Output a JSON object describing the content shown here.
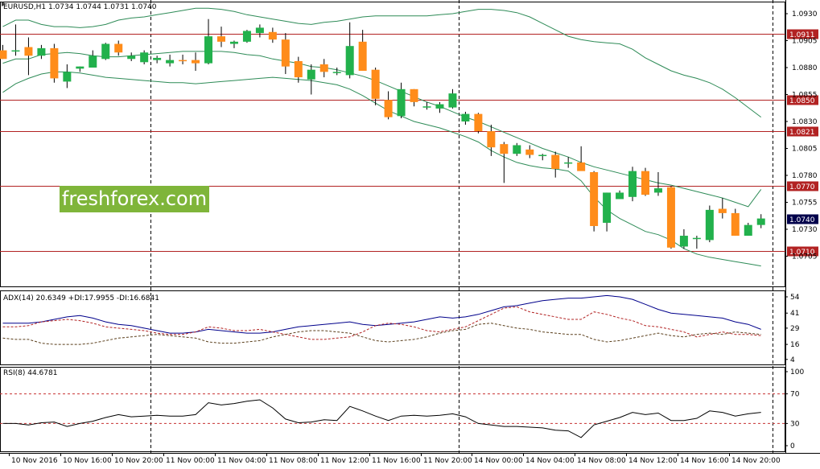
{
  "symbol_header": "EURUSD,H1  1.0734 1.0744 1.0731 1.0740",
  "brand_text": "freshforex.com",
  "colors": {
    "bull": "#22b14c",
    "bear": "#ff8c1a",
    "level": "#b22222",
    "band": "#2e8b57",
    "adx": "#00008b",
    "di_plus": "#b22222",
    "di_minus": "#5a3e1b",
    "rsi": "#000000",
    "rsi_level": "#c83232",
    "grid": "#000000",
    "current_bg": "#00004b"
  },
  "chart_data": [
    {
      "type": "candlestick",
      "title": "EURUSD,H1",
      "ohlc_header": "1.0734 1.0744 1.0731 1.0740",
      "ylim": [
        1.07,
        1.0935
      ],
      "y_ticks": [
        "1.0930",
        "1.0905",
        "1.0880",
        "1.0855",
        "1.0830",
        "1.0805",
        "1.0780",
        "1.0755",
        "1.0730",
        "1.0705"
      ],
      "x_tick_labels": [
        "10 Nov 2016",
        "10 Nov 16:00",
        "10 Nov 20:00",
        "11 Nov 00:00",
        "11 Nov 04:00",
        "11 Nov 08:00",
        "11 Nov 12:00",
        "11 Nov 16:00",
        "11 Nov 20:00",
        "14 Nov 00:00",
        "14 Nov 04:00",
        "14 Nov 08:00",
        "14 Nov 12:00",
        "14 Nov 16:00",
        "14 Nov 20:00"
      ],
      "x_tick_candle_index": [
        1,
        5,
        9,
        13,
        17,
        21,
        25,
        29,
        33,
        37,
        41,
        45,
        49,
        53,
        57
      ],
      "period_separator_candle_index": [
        12,
        36
      ],
      "levels": [
        {
          "value": 1.0911,
          "label": "1.0911"
        },
        {
          "value": 1.085,
          "label": "1.0850"
        },
        {
          "value": 1.0821,
          "label": "1.0821"
        },
        {
          "value": 1.077,
          "label": "1.0770"
        },
        {
          "value": 1.071,
          "label": "1.0710"
        }
      ],
      "current_price": {
        "value": 1.074,
        "label": "1.0740"
      },
      "candles": [
        [
          1.0896,
          1.0901,
          1.0888,
          1.0888
        ],
        [
          1.0896,
          1.092,
          1.0891,
          1.0896
        ],
        [
          1.0899,
          1.0908,
          1.0873,
          1.0891
        ],
        [
          1.0891,
          1.0901,
          1.0888,
          1.0898
        ],
        [
          1.0898,
          1.0902,
          1.0866,
          1.087
        ],
        [
          1.0867,
          1.0883,
          1.0861,
          1.0876
        ],
        [
          1.0879,
          1.0881,
          1.0876,
          1.0881
        ],
        [
          1.088,
          1.0896,
          1.088,
          1.0891
        ],
        [
          1.0888,
          1.0903,
          1.0887,
          1.0902
        ],
        [
          1.0902,
          1.0905,
          1.0891,
          1.0894
        ],
        [
          1.0888,
          1.0894,
          1.0886,
          1.0891
        ],
        [
          1.0885,
          1.0896,
          1.0883,
          1.0894
        ],
        [
          1.0887,
          1.0891,
          1.0884,
          1.0889
        ],
        [
          1.0884,
          1.0892,
          1.0881,
          1.0887
        ],
        [
          1.0887,
          1.0892,
          1.0883,
          1.0886
        ],
        [
          1.0887,
          1.0894,
          1.0877,
          1.0884
        ],
        [
          1.0884,
          1.0925,
          1.0883,
          1.0909
        ],
        [
          1.0909,
          1.0918,
          1.0899,
          1.0904
        ],
        [
          1.0902,
          1.0905,
          1.0898,
          1.0904
        ],
        [
          1.0904,
          1.0915,
          1.0903,
          1.0914
        ],
        [
          1.0912,
          1.092,
          1.0908,
          1.0917
        ],
        [
          1.0913,
          1.0917,
          1.0903,
          1.0906
        ],
        [
          1.0906,
          1.0912,
          1.0874,
          1.0881
        ],
        [
          1.0886,
          1.089,
          1.0866,
          1.0871
        ],
        [
          1.0869,
          1.0883,
          1.0855,
          1.0878
        ],
        [
          1.0883,
          1.0888,
          1.0871,
          1.0876
        ],
        [
          1.0876,
          1.088,
          1.0873,
          1.0876
        ],
        [
          1.0873,
          1.0922,
          1.087,
          1.09
        ],
        [
          1.0904,
          1.0915,
          1.0877,
          1.0877
        ],
        [
          1.0878,
          1.088,
          1.0845,
          1.0851
        ],
        [
          1.085,
          1.0858,
          1.0832,
          1.0834
        ],
        [
          1.0835,
          1.0866,
          1.0833,
          1.086
        ],
        [
          1.086,
          1.086,
          1.0844,
          1.0848
        ],
        [
          1.0844,
          1.0848,
          1.0841,
          1.0844
        ],
        [
          1.0842,
          1.0848,
          1.0838,
          1.0846
        ],
        [
          1.0843,
          1.086,
          1.0842,
          1.0856
        ],
        [
          1.083,
          1.0839,
          1.0827,
          1.0837
        ],
        [
          1.0837,
          1.0838,
          1.0819,
          1.0821
        ],
        [
          1.0821,
          1.0827,
          1.0798,
          1.0806
        ],
        [
          1.0809,
          1.0811,
          1.0773,
          1.08
        ],
        [
          1.08,
          1.081,
          1.0798,
          1.0808
        ],
        [
          1.0804,
          1.0808,
          1.0796,
          1.0799
        ],
        [
          1.0798,
          1.08,
          1.0794,
          1.0799
        ],
        [
          1.0799,
          1.0802,
          1.0778,
          1.0786
        ],
        [
          1.0792,
          1.0797,
          1.0787,
          1.0792
        ],
        [
          1.0792,
          1.0807,
          1.0787,
          1.0784
        ],
        [
          1.0783,
          1.0784,
          1.0728,
          1.0733
        ],
        [
          1.0736,
          1.0764,
          1.0728,
          1.0764
        ],
        [
          1.0758,
          1.0766,
          1.0758,
          1.0764
        ],
        [
          1.076,
          1.0788,
          1.0756,
          1.0784
        ],
        [
          1.0784,
          1.0787,
          1.0761,
          1.0762
        ],
        [
          1.0764,
          1.0783,
          1.0761,
          1.0768
        ],
        [
          1.0769,
          1.077,
          1.0712,
          1.0713
        ],
        [
          1.0714,
          1.073,
          1.0712,
          1.0724
        ],
        [
          1.0722,
          1.0724,
          1.0712,
          1.0722
        ],
        [
          1.072,
          1.0752,
          1.0718,
          1.0748
        ],
        [
          1.0749,
          1.0759,
          1.074,
          1.0745
        ],
        [
          1.0745,
          1.0749,
          1.0724,
          1.0724
        ],
        [
          1.0724,
          1.0736,
          1.0724,
          1.0734
        ],
        [
          1.0734,
          1.0744,
          1.0731,
          1.074
        ]
      ],
      "bollinger_upper": [
        1.0918,
        1.0924,
        1.0924,
        1.092,
        1.0918,
        1.0918,
        1.0917,
        1.0918,
        1.092,
        1.0924,
        1.0926,
        1.0927,
        1.0929,
        1.0931,
        1.0933,
        1.0935,
        1.0935,
        1.0934,
        1.0932,
        1.0929,
        1.0927,
        1.0925,
        1.0923,
        1.0921,
        1.092,
        1.0922,
        1.0923,
        1.0925,
        1.0927,
        1.0928,
        1.0928,
        1.0928,
        1.0928,
        1.0928,
        1.0929,
        1.093,
        1.0932,
        1.0934,
        1.0934,
        1.0933,
        1.0931,
        1.0927,
        1.0921,
        1.0915,
        1.0909,
        1.0906,
        1.0904,
        1.0903,
        1.0902,
        1.0897,
        1.0889,
        1.0883,
        1.0877,
        1.0873,
        1.087,
        1.0866,
        1.086,
        1.0852,
        1.0843,
        1.0834
      ],
      "bollinger_middle": [
        1.0884,
        1.0888,
        1.0888,
        1.0892,
        1.0893,
        1.0894,
        1.0893,
        1.0891,
        1.089,
        1.089,
        1.0891,
        1.0892,
        1.0893,
        1.0894,
        1.0895,
        1.0895,
        1.0895,
        1.0895,
        1.0894,
        1.0892,
        1.0891,
        1.0888,
        1.0886,
        1.0884,
        1.0881,
        1.088,
        1.0878,
        1.0875,
        1.0872,
        1.0868,
        1.0863,
        1.0858,
        1.0853,
        1.0848,
        1.0844,
        1.0839,
        1.0834,
        1.083,
        1.0825,
        1.082,
        1.0815,
        1.081,
        1.0805,
        1.0801,
        1.0797,
        1.0792,
        1.0788,
        1.0785,
        1.0782,
        1.0779,
        1.0776,
        1.0773,
        1.0771,
        1.0768,
        1.0765,
        1.0762,
        1.0759,
        1.0755,
        1.0751,
        1.0767
      ],
      "bollinger_lower": [
        1.0857,
        1.0865,
        1.087,
        1.0874,
        1.0876,
        1.0876,
        1.0875,
        1.0873,
        1.0871,
        1.087,
        1.0869,
        1.0868,
        1.0867,
        1.0866,
        1.0866,
        1.0865,
        1.0866,
        1.0867,
        1.0868,
        1.0869,
        1.087,
        1.0871,
        1.087,
        1.0869,
        1.0868,
        1.0866,
        1.0864,
        1.086,
        1.0854,
        1.0847,
        1.084,
        1.0835,
        1.083,
        1.0827,
        1.0824,
        1.082,
        1.0816,
        1.0811,
        1.0803,
        1.0797,
        1.0792,
        1.0789,
        1.0787,
        1.0786,
        1.0784,
        1.0775,
        1.076,
        1.0748,
        1.074,
        1.0734,
        1.0728,
        1.0725,
        1.072,
        1.0712,
        1.0707,
        1.0704,
        1.0702,
        1.07,
        1.0698,
        1.0696
      ]
    },
    {
      "type": "line",
      "title": "ADX(14) 20.6349 +DI:17.9955 -DI:16.6841",
      "ylim": [
        0,
        56
      ],
      "y_ticks": [
        "54",
        "41",
        "29",
        "16",
        "4"
      ],
      "series": [
        {
          "name": "ADX(14)",
          "style": "solid",
          "values": [
            33,
            33,
            33,
            34,
            36,
            38,
            39,
            37,
            34,
            32,
            31,
            29,
            27,
            25,
            25,
            26,
            28,
            27,
            26,
            25,
            25,
            26,
            28,
            30,
            31,
            32,
            33,
            34,
            32,
            31,
            32,
            33,
            34,
            36,
            38,
            37,
            38,
            40,
            43,
            46,
            47,
            49,
            51,
            52,
            53,
            53,
            54,
            55,
            54,
            52,
            48,
            44,
            41,
            40,
            39,
            38,
            37,
            34,
            32,
            28
          ]
        },
        {
          "name": "+DI",
          "style": "dashed",
          "values": [
            30,
            30,
            31,
            34,
            35,
            36,
            35,
            33,
            30,
            29,
            28,
            27,
            25,
            24,
            24,
            26,
            30,
            29,
            27,
            27,
            28,
            26,
            24,
            22,
            20,
            20,
            21,
            22,
            26,
            31,
            33,
            32,
            30,
            27,
            26,
            28,
            30,
            35,
            40,
            45,
            46,
            42,
            40,
            38,
            36,
            36,
            42,
            40,
            37,
            35,
            31,
            30,
            28,
            26,
            22,
            24,
            26,
            24,
            24,
            23
          ]
        },
        {
          "name": "-DI",
          "style": "dashed",
          "values": [
            21,
            20,
            20,
            17,
            16,
            16,
            16,
            17,
            19,
            21,
            22,
            23,
            24,
            23,
            22,
            21,
            18,
            17,
            17,
            18,
            19,
            22,
            24,
            26,
            27,
            27,
            26,
            25,
            22,
            19,
            18,
            19,
            20,
            22,
            25,
            27,
            28,
            32,
            33,
            31,
            29,
            28,
            26,
            25,
            24,
            24,
            20,
            18,
            19,
            21,
            23,
            25,
            23,
            22,
            24,
            25,
            24,
            26,
            25,
            24
          ]
        }
      ]
    },
    {
      "type": "line",
      "title": "RSI(8) 44.6781",
      "ylim": [
        0,
        100
      ],
      "y_ticks": [
        "100",
        "70",
        "30",
        "0"
      ],
      "levels": [
        70,
        30
      ],
      "series": [
        {
          "name": "RSI(8)",
          "style": "solid",
          "values": [
            30,
            30,
            28,
            31,
            32,
            26,
            30,
            33,
            38,
            42,
            39,
            40,
            41,
            40,
            40,
            42,
            58,
            55,
            57,
            60,
            62,
            51,
            36,
            31,
            32,
            35,
            34,
            53,
            47,
            40,
            34,
            40,
            41,
            40,
            41,
            43,
            39,
            30,
            28,
            26,
            26,
            25,
            24,
            21,
            20,
            11,
            28,
            33,
            38,
            45,
            42,
            44,
            34,
            34,
            37,
            47,
            45,
            40,
            43,
            45
          ]
        }
      ]
    }
  ]
}
